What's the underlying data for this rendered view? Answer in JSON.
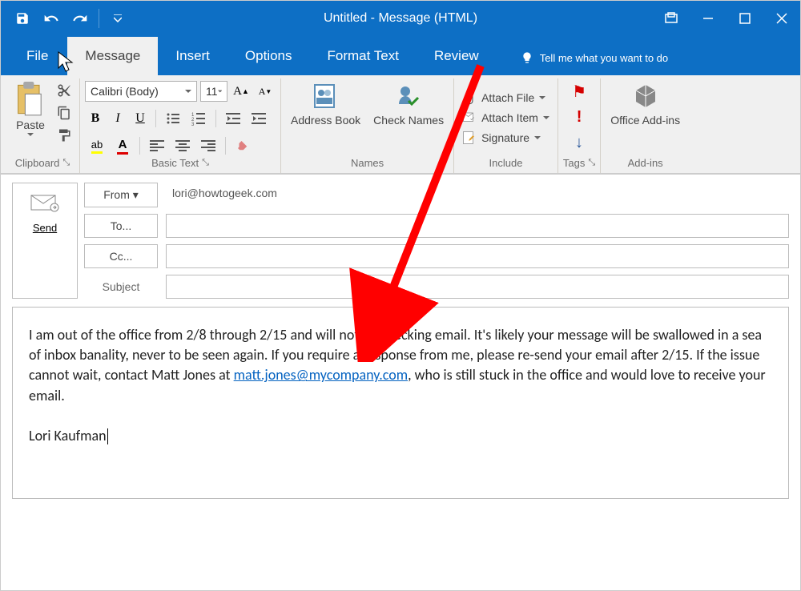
{
  "titlebar": {
    "title": "Untitled - Message (HTML)"
  },
  "tabs": {
    "file": "File",
    "message": "Message",
    "insert": "Insert",
    "options": "Options",
    "format_text": "Format Text",
    "review": "Review",
    "tell_me": "Tell me what you want to do"
  },
  "ribbon": {
    "clipboard": {
      "label": "Clipboard",
      "paste": "Paste"
    },
    "basic_text": {
      "label": "Basic Text",
      "font": "Calibri (Body)",
      "size": "11"
    },
    "names": {
      "label": "Names",
      "address_book": "Address Book",
      "check_names": "Check Names"
    },
    "include": {
      "label": "Include",
      "attach_file": "Attach File",
      "attach_item": "Attach Item",
      "signature": "Signature"
    },
    "tags": {
      "label": "Tags"
    },
    "addins": {
      "label": "Add-ins",
      "office": "Office Add-ins"
    }
  },
  "compose": {
    "send": "Send",
    "from_label": "From",
    "from_value": "lori@howtogeek.com",
    "to_label": "To...",
    "cc_label": "Cc...",
    "subject_label": "Subject"
  },
  "body": {
    "text_before_link": "I am out of the office from 2/8 through 2/15 and will not be checking email. It's likely your message will be swallowed in a sea of inbox banality, never to be seen again. If you require a response from me, please re-send your email after 2/15. If the issue cannot wait, contact Matt Jones at ",
    "link_text": "matt.jones@mycompany.com",
    "text_after_link": ", who is still stuck in the office and would love to receive your email.",
    "signature": "Lori Kaufman"
  }
}
